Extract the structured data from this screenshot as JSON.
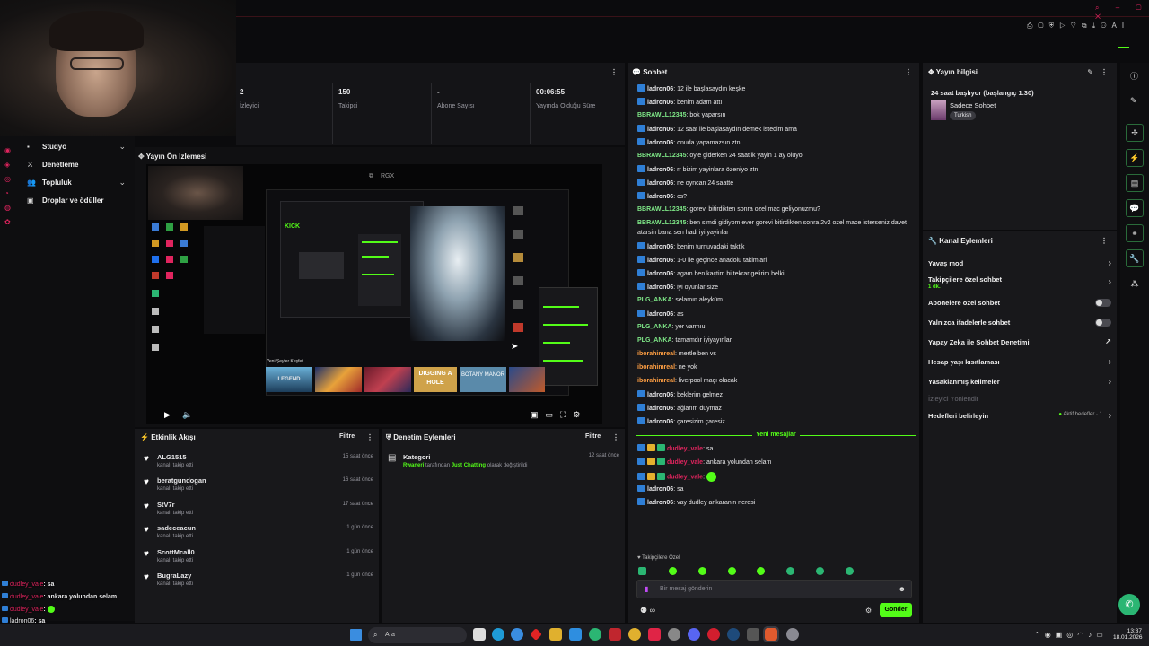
{
  "topbar": {
    "icons": [
      "bookmark-icon",
      "crop-icon",
      "shield-icon",
      "play-icon",
      "heart-icon",
      "extensions-icon",
      "download-icon",
      "profile-icon"
    ],
    "ai_label": "AI"
  },
  "sidebar": {
    "items": [
      {
        "label": "Stüdyo",
        "chevron": true,
        "icon": "camera-icon"
      },
      {
        "label": "Denetleme",
        "chevron": false,
        "icon": "sword-icon"
      },
      {
        "label": "Topluluk",
        "chevron": true,
        "icon": "people-icon"
      },
      {
        "label": "Droplar ve ödüller",
        "chevron": false,
        "icon": "gift-icon"
      }
    ]
  },
  "stats": [
    {
      "value": "2",
      "label": "İzleyici"
    },
    {
      "value": "150",
      "label": "Takipçi"
    },
    {
      "value": "-",
      "label": "Abone Sayısı"
    },
    {
      "value": "00:06:55",
      "label": "Yayında Olduğu Süre"
    }
  ],
  "preview": {
    "title": "Yayın Ön İzlemesi"
  },
  "activity": {
    "title": "Etkinlik Akışı",
    "filter": "Filtre",
    "items": [
      {
        "name": "ALG1515",
        "desc": "kanalı takip etti",
        "time": "15 saat önce"
      },
      {
        "name": "beratgundogan",
        "desc": "kanalı takip etti",
        "time": "16 saat önce"
      },
      {
        "name": "StV7r",
        "desc": "kanalı takip etti",
        "time": "17 saat önce"
      },
      {
        "name": "sadeceacun",
        "desc": "kanalı takip etti",
        "time": "1 gün önce"
      },
      {
        "name": "ScottMcall0",
        "desc": "kanalı takip etti",
        "time": "1 gün önce"
      },
      {
        "name": "BugraLazy",
        "desc": "kanalı takip etti",
        "time": "1 gün önce"
      }
    ]
  },
  "moderation": {
    "title": "Denetim Eylemleri",
    "filter": "Filtre",
    "item": {
      "title": "Kategori",
      "user": "Rwaneri",
      "mid": "tarafından",
      "category": "Just Chatting",
      "end": "olarak değiştirildi",
      "time": "12 saat önce"
    }
  },
  "chat": {
    "title": "Sohbet",
    "messages": [
      {
        "user": "ladron06",
        "text": "12 ile başlasaydın keşke",
        "color": "#e8e8ea",
        "badge": "mod"
      },
      {
        "user": "ladron06",
        "text": "benim adam attı",
        "color": "#e8e8ea",
        "badge": "mod"
      },
      {
        "user": "BBRAWLL12345",
        "text": "bok yaparsın",
        "color": "#7ee787",
        "badge": ""
      },
      {
        "user": "ladron06",
        "text": "12 saat ile başlasaydın demek istedim ama",
        "color": "#e8e8ea",
        "badge": "mod"
      },
      {
        "user": "ladron06",
        "text": "onuda yapamazsın ztn",
        "color": "#e8e8ea",
        "badge": "mod"
      },
      {
        "user": "BBRAWLL12345",
        "text": "oyle giderken 24 saatlik yayin 1 ay oluyo",
        "color": "#7ee787",
        "badge": ""
      },
      {
        "user": "ladron06",
        "text": "rr bizim yayinlara özeniyo ztn",
        "color": "#e8e8ea",
        "badge": "mod"
      },
      {
        "user": "ladron06",
        "text": "ne oyncan 24 saatte",
        "color": "#e8e8ea",
        "badge": "mod"
      },
      {
        "user": "ladron06",
        "text": "cs?",
        "color": "#e8e8ea",
        "badge": "mod"
      },
      {
        "user": "BBRAWLL12345",
        "text": "gorevi bitirdikten sonra ozel mac geliyonuzmu?",
        "color": "#7ee787",
        "badge": ""
      },
      {
        "user": "BBRAWLL12345",
        "text": "ben simdi gidiyom ever gorevi bitirdikten sonra 2v2 ozel mace isterseniz davet",
        "text2": "atarsin bana sen hadi iyi yayinlar",
        "color": "#7ee787",
        "badge": ""
      },
      {
        "user": "ladron06",
        "text": "benim turnuvadaki taktik",
        "color": "#e8e8ea",
        "badge": "mod"
      },
      {
        "user": "ladron06",
        "text": "1-0 ile geçince anadolu takimlari",
        "color": "#e8e8ea",
        "badge": "mod"
      },
      {
        "user": "ladron06",
        "text": "agam ben kaçtim bi tekrar gelirim belki",
        "color": "#e8e8ea",
        "badge": "mod"
      },
      {
        "user": "ladron06",
        "text": "iyi oyunlar size",
        "color": "#e8e8ea",
        "badge": "mod"
      },
      {
        "user": "PLG_ANKA",
        "text": "selamın aleyküm",
        "color": "#7ee787",
        "badge": ""
      },
      {
        "user": "ladron06",
        "text": "as",
        "color": "#e8e8ea",
        "badge": "mod"
      },
      {
        "user": "PLG_ANKA",
        "text": "yer varmıu",
        "color": "#7ee787",
        "badge": ""
      },
      {
        "user": "PLG_ANKA",
        "text": "tamamdır iyiyayınlar",
        "color": "#7ee787",
        "badge": ""
      },
      {
        "user": "iborahimreal",
        "text": "mertle ben vs",
        "color": "#ff9f43",
        "badge": ""
      },
      {
        "user": "iborahimreal",
        "text": "ne yok",
        "color": "#ff9f43",
        "badge": ""
      },
      {
        "user": "iborahimreal",
        "text": "liverpool maçı olacak",
        "color": "#ff9f43",
        "badge": ""
      },
      {
        "user": "ladron06",
        "text": "beklerim gelmez",
        "color": "#e8e8ea",
        "badge": "mod"
      },
      {
        "user": "ladron06",
        "text": "ağlarım duymaz",
        "color": "#e8e8ea",
        "badge": "mod"
      },
      {
        "user": "ladron06",
        "text": "çaresizim çaresiz",
        "color": "#e8e8ea",
        "badge": "mod"
      }
    ],
    "new_label": "Yeni mesajlar",
    "new_messages": [
      {
        "user": "dudley_vale",
        "text": "sa",
        "color": "#e0245e",
        "badges": 3
      },
      {
        "user": "dudley_vale",
        "text": "ankara yolundan selam",
        "color": "#e0245e",
        "badges": 3
      },
      {
        "user": "dudley_vale",
        "text": "",
        "emote": true,
        "color": "#e0245e",
        "badges": 3
      },
      {
        "user": "ladron06",
        "text": "sa",
        "color": "#e8e8ea",
        "badges": 1
      },
      {
        "user": "ladron06",
        "text": "vay dudley ankaranin neresi",
        "color": "#e8e8ea",
        "badges": 1
      }
    ],
    "followers_only": "Takipçilere Özel",
    "input_placeholder": "Bir mesaj gönderin",
    "send": "Gönder",
    "points": "∞"
  },
  "stream_info": {
    "title": "Yayın bilgisi",
    "stream_title": "24 saat başlıyor (başlangıç 1.30)",
    "category": "Sadece Sohbet",
    "tag": "Turkish"
  },
  "channel_actions": {
    "title": "Kanal Eylemleri",
    "items": [
      {
        "label": "Yavaş mod",
        "control": "chevron"
      },
      {
        "label": "Takipçilere özel sohbet",
        "sub": "1 dk.",
        "control": "chevron"
      },
      {
        "label": "Abonelere özel sohbet",
        "control": "toggle"
      },
      {
        "label": "Yalnızca ifadelerle sohbet",
        "control": "toggle"
      },
      {
        "label": "Yapay Zeka ile Sohbet Denetimi",
        "control": "external"
      },
      {
        "label": "Hesap yaşı kısıtlaması",
        "control": "chevron"
      },
      {
        "label": "Yasaklanmış kelimeler",
        "control": "chevron"
      },
      {
        "label": "İzleyici Yönlendir",
        "control": "none",
        "muted": true
      },
      {
        "label": "Hedefleri belirleyin",
        "control": "chevron",
        "right": "Aktif hedefler · 1"
      }
    ]
  },
  "overlay_chat": [
    {
      "user": "dudley_vale",
      "text": ": sa",
      "color": "#e0245e"
    },
    {
      "user": "dudley_vale",
      "text": ": ankara yolundan selam",
      "color": "#e0245e"
    },
    {
      "user": "dudley_vale",
      "text": ":",
      "color": "#e0245e",
      "emote": true
    },
    {
      "user": "ladron06",
      "text": ": sa",
      "color": "#e8e8ea"
    },
    {
      "user": "ladron06",
      "text": ": vay dudley ankaranin neresi",
      "color": "#e8e8ea"
    }
  ],
  "taskbar": {
    "search": "Ara",
    "time": "13:37",
    "date": "18.01.2026"
  },
  "embedded": {
    "kick_label": "KICK",
    "new_games": "Yeni Şeyler Keşfet",
    "games": [
      "LEGEND",
      "",
      "",
      "DIGGING A HOLE",
      "BOTANY MANOR",
      ""
    ],
    "rgx": "RGX"
  },
  "colors": {
    "accent": "#53fc18",
    "bg": "#0b0b0d",
    "panel": "#18181b"
  }
}
